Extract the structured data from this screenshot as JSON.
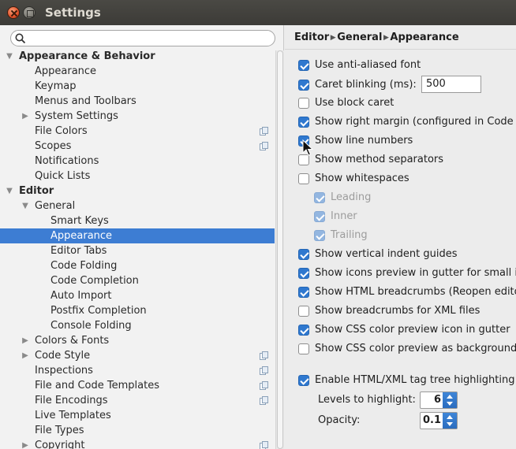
{
  "window": {
    "title": "Settings"
  },
  "search": {
    "placeholder": ""
  },
  "tree": [
    {
      "label": "Appearance & Behavior",
      "level": 0,
      "arrow": "expanded",
      "category": true,
      "icon": false,
      "selected": false
    },
    {
      "label": "Appearance",
      "level": 1,
      "arrow": "none",
      "category": false,
      "icon": false,
      "selected": false
    },
    {
      "label": "Keymap",
      "level": 1,
      "arrow": "none",
      "category": false,
      "icon": false,
      "selected": false
    },
    {
      "label": "Menus and Toolbars",
      "level": 1,
      "arrow": "none",
      "category": false,
      "icon": false,
      "selected": false
    },
    {
      "label": "System Settings",
      "level": 1,
      "arrow": "collapsed",
      "category": false,
      "icon": false,
      "selected": false
    },
    {
      "label": "File Colors",
      "level": 1,
      "arrow": "none",
      "category": false,
      "icon": true,
      "selected": false
    },
    {
      "label": "Scopes",
      "level": 1,
      "arrow": "none",
      "category": false,
      "icon": true,
      "selected": false
    },
    {
      "label": "Notifications",
      "level": 1,
      "arrow": "none",
      "category": false,
      "icon": false,
      "selected": false
    },
    {
      "label": "Quick Lists",
      "level": 1,
      "arrow": "none",
      "category": false,
      "icon": false,
      "selected": false
    },
    {
      "label": "Editor",
      "level": 0,
      "arrow": "expanded",
      "category": true,
      "icon": false,
      "selected": false
    },
    {
      "label": "General",
      "level": 1,
      "arrow": "expanded",
      "category": false,
      "icon": false,
      "selected": false
    },
    {
      "label": "Smart Keys",
      "level": 2,
      "arrow": "none",
      "category": false,
      "icon": false,
      "selected": false
    },
    {
      "label": "Appearance",
      "level": 2,
      "arrow": "none",
      "category": false,
      "icon": false,
      "selected": true
    },
    {
      "label": "Editor Tabs",
      "level": 2,
      "arrow": "none",
      "category": false,
      "icon": false,
      "selected": false
    },
    {
      "label": "Code Folding",
      "level": 2,
      "arrow": "none",
      "category": false,
      "icon": false,
      "selected": false
    },
    {
      "label": "Code Completion",
      "level": 2,
      "arrow": "none",
      "category": false,
      "icon": false,
      "selected": false
    },
    {
      "label": "Auto Import",
      "level": 2,
      "arrow": "none",
      "category": false,
      "icon": false,
      "selected": false
    },
    {
      "label": "Postfix Completion",
      "level": 2,
      "arrow": "none",
      "category": false,
      "icon": false,
      "selected": false
    },
    {
      "label": "Console Folding",
      "level": 2,
      "arrow": "none",
      "category": false,
      "icon": false,
      "selected": false
    },
    {
      "label": "Colors & Fonts",
      "level": 1,
      "arrow": "collapsed",
      "category": false,
      "icon": false,
      "selected": false
    },
    {
      "label": "Code Style",
      "level": 1,
      "arrow": "collapsed",
      "category": false,
      "icon": true,
      "selected": false
    },
    {
      "label": "Inspections",
      "level": 1,
      "arrow": "none",
      "category": false,
      "icon": true,
      "selected": false
    },
    {
      "label": "File and Code Templates",
      "level": 1,
      "arrow": "none",
      "category": false,
      "icon": true,
      "selected": false
    },
    {
      "label": "File Encodings",
      "level": 1,
      "arrow": "none",
      "category": false,
      "icon": true,
      "selected": false
    },
    {
      "label": "Live Templates",
      "level": 1,
      "arrow": "none",
      "category": false,
      "icon": false,
      "selected": false
    },
    {
      "label": "File Types",
      "level": 1,
      "arrow": "none",
      "category": false,
      "icon": false,
      "selected": false
    },
    {
      "label": "Copyright",
      "level": 1,
      "arrow": "collapsed",
      "category": false,
      "icon": true,
      "selected": false
    }
  ],
  "breadcrumb": [
    "Editor",
    "General",
    "Appearance"
  ],
  "options": [
    {
      "label": "Use anti-aliased font",
      "checked": true,
      "indent": false,
      "disabled": false
    },
    {
      "label": "Caret blinking (ms):",
      "checked": true,
      "indent": false,
      "disabled": false
    },
    {
      "label": "Use block caret",
      "checked": false,
      "indent": false,
      "disabled": false
    },
    {
      "label": "Show right margin (configured in Code Style options)",
      "checked": true,
      "indent": false,
      "disabled": false
    },
    {
      "label": "Show line numbers",
      "checked": true,
      "indent": false,
      "disabled": false
    },
    {
      "label": "Show method separators",
      "checked": false,
      "indent": false,
      "disabled": false
    },
    {
      "label": "Show whitespaces",
      "checked": false,
      "indent": false,
      "disabled": false
    },
    {
      "label": "Leading",
      "checked": true,
      "indent": true,
      "disabled": true
    },
    {
      "label": "Inner",
      "checked": true,
      "indent": true,
      "disabled": true
    },
    {
      "label": "Trailing",
      "checked": true,
      "indent": true,
      "disabled": true
    },
    {
      "label": "Show vertical indent guides",
      "checked": true,
      "indent": false,
      "disabled": false
    },
    {
      "label": "Show icons preview in gutter for small icons",
      "checked": true,
      "indent": false,
      "disabled": false
    },
    {
      "label": "Show HTML breadcrumbs (Reopen editors to apply)",
      "checked": true,
      "indent": false,
      "disabled": false
    },
    {
      "label": "Show breadcrumbs for XML files",
      "checked": false,
      "indent": false,
      "disabled": false
    },
    {
      "label": "Show CSS color preview icon in gutter",
      "checked": true,
      "indent": false,
      "disabled": false
    },
    {
      "label": "Show CSS color preview as background",
      "checked": false,
      "indent": false,
      "disabled": false
    }
  ],
  "caret_blinking_value": "500",
  "tag_tree": {
    "label": "Enable HTML/XML tag tree highlighting",
    "checked": true,
    "levels_label": "Levels to highlight:",
    "levels_value": "6",
    "opacity_label": "Opacity:",
    "opacity_value": "0.1"
  },
  "colors": {
    "selection": "#3d7dd3",
    "checkbox_checked": "#2f78cf",
    "titlebar": "#3c3b37"
  },
  "icons": [
    "search-icon",
    "close-icon",
    "maximize-icon",
    "expand-arrow-icon",
    "collapse-arrow-icon",
    "project-level-icon",
    "mouse-cursor-icon"
  ]
}
